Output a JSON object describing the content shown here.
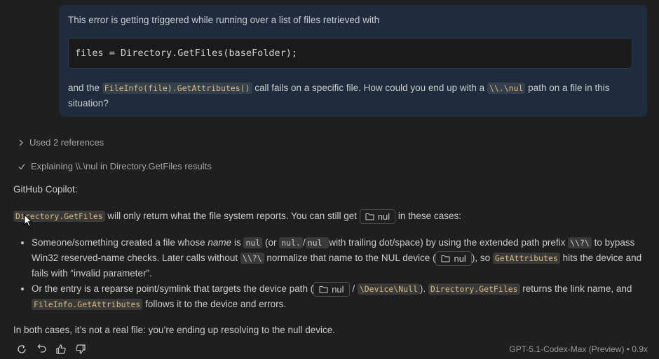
{
  "user_message": {
    "intro": "This error is getting triggered while running over a list of files retrieved with",
    "code": "files = Directory.GetFiles(baseFolder);",
    "p2_before": "and the ",
    "p2_code1": "FileInfo(file).GetAttributes()",
    "p2_mid": " call fails on a specific file. How could you end up with a ",
    "p2_code2": "\\\\.\\nul",
    "p2_after": " path on a file in this situation?"
  },
  "status": {
    "references": "Used 2 references",
    "explaining": "Explaining \\\\.\\nul in Directory.GetFiles results"
  },
  "assistant": {
    "label": "GitHub Copilot:",
    "intro_code": "Directory.GetFiles",
    "intro_text": " will only return what the file system reports. You can still get ",
    "intro_chip": "nul",
    "intro_after": " in these cases:",
    "b1_t1": "Someone/something created a file whose ",
    "b1_em": "name",
    "b1_t2": " is ",
    "b1_c1": "nul",
    "b1_t3": " (or ",
    "b1_c2": "nul.",
    "b1_t4": "/",
    "b1_c3": "nul ",
    "b1_t5": " with trailing dot/space) by using the extended path prefix ",
    "b1_c4": "\\\\?\\",
    "b1_t6": " to bypass Win32 reserved-name checks. Later calls without ",
    "b1_c5": "\\\\?\\",
    "b1_t7": " normalize that name to the NUL device (",
    "b1_chip": "nul",
    "b1_t8": "), so ",
    "b1_c6": "GetAttributes",
    "b1_t9": " hits the device and fails with “invalid parameter”.",
    "b2_t1": "Or the entry is a reparse point/symlink that targets the device path (",
    "b2_chip": "nul",
    "b2_t2": " / ",
    "b2_c1": "\\Device\\Null",
    "b2_t3": "). ",
    "b2_c2": "Directory.GetFiles",
    "b2_t4": " returns the link name, and ",
    "b2_c3": "FileInfo.GetAttributes",
    "b2_t5": " follows it to the device and errors.",
    "final": "In both cases, it’s not a real file: you’re ending up resolving to the null device."
  },
  "footer": {
    "model": "GPT-5.1-Codex-Max (Preview) • 0.9x"
  },
  "icons": {
    "retry": "retry-icon",
    "undo": "undo-icon",
    "thumbs_up": "thumbs-up-icon",
    "thumbs_down": "thumbs-down-icon",
    "folder": "folder-icon"
  }
}
